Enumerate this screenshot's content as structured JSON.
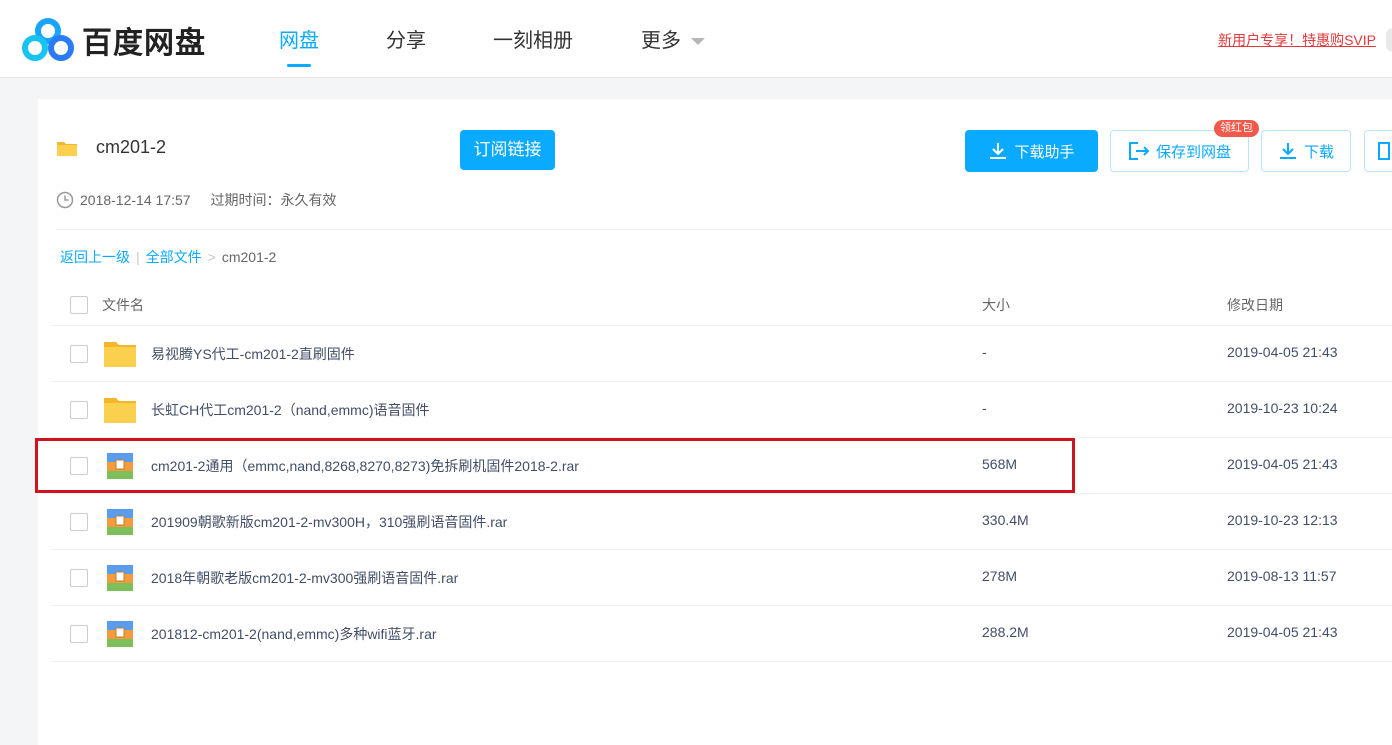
{
  "header": {
    "logo_text": "百度网盘",
    "nav": [
      {
        "label": "网盘",
        "active": true
      },
      {
        "label": "分享",
        "active": false
      },
      {
        "label": "一刻相册",
        "active": false
      },
      {
        "label": "更多",
        "active": false
      }
    ],
    "promo": "新用户专享！特惠购SVIP",
    "accent": "#09aaff"
  },
  "share": {
    "title": "cm201-2",
    "subscribe_label": "订阅链接",
    "created": "2018-12-14 17:57",
    "expire": "过期时间：永久有效",
    "buttons": {
      "download_helper": "下载助手",
      "save_to_disk": "保存到网盘",
      "download": "下载",
      "badge": "领红包"
    }
  },
  "breadcrumb": {
    "back": "返回上一级",
    "separator": "|",
    "all_files": "全部文件",
    "arrow": ">",
    "current": "cm201-2"
  },
  "table": {
    "headers": {
      "name": "文件名",
      "size": "大小",
      "date": "修改日期"
    },
    "rows": [
      {
        "name": "易视腾YS代工-cm201-2直刷固件",
        "size": "-",
        "date": "2019-04-05 21:43",
        "type": "folder",
        "highlighted": false
      },
      {
        "name": "长虹CH代工cm201-2（nand,emmc)语音固件",
        "size": "-",
        "date": "2019-10-23 10:24",
        "type": "folder",
        "highlighted": false
      },
      {
        "name": "cm201-2通用（emmc,nand,8268,8270,8273)免拆刷机固件2018-2.rar",
        "size": "568M",
        "date": "2019-04-05 21:43",
        "type": "rar",
        "highlighted": true
      },
      {
        "name": "201909朝歌新版cm201-2-mv300H，310强刷语音固件.rar",
        "size": "330.4M",
        "date": "2019-10-23 12:13",
        "type": "rar",
        "highlighted": false
      },
      {
        "name": "2018年朝歌老版cm201-2-mv300强刷语音固件.rar",
        "size": "278M",
        "date": "2019-08-13 11:57",
        "type": "rar",
        "highlighted": false
      },
      {
        "name": "201812-cm201-2(nand,emmc)多种wifi蓝牙.rar",
        "size": "288.2M",
        "date": "2019-04-05 21:43",
        "type": "rar",
        "highlighted": false
      }
    ]
  }
}
